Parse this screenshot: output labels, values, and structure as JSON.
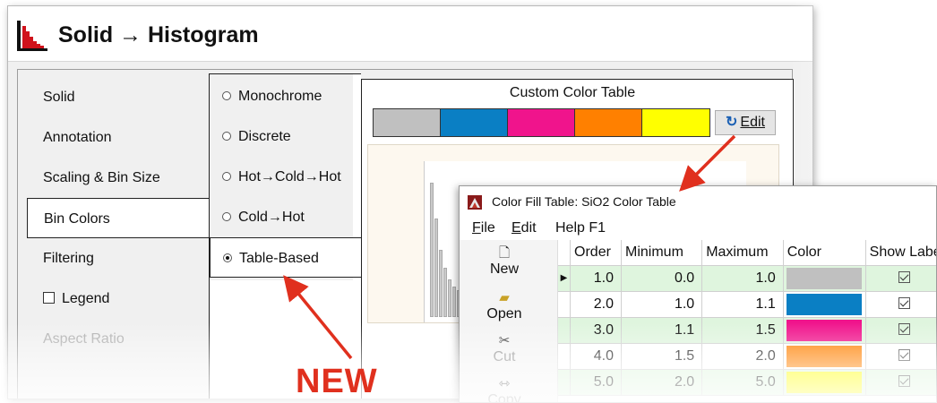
{
  "window": {
    "title": "Solid → Histogram"
  },
  "nav": {
    "items": [
      {
        "label": "Solid"
      },
      {
        "label": "Annotation"
      },
      {
        "label": "Scaling & Bin Size"
      },
      {
        "label": "Bin Colors"
      },
      {
        "label": "Filtering"
      },
      {
        "label": "Legend"
      },
      {
        "label": "Aspect Ratio"
      }
    ],
    "selected": "Bin Colors"
  },
  "color_mode": {
    "options": [
      {
        "label": "Monochrome"
      },
      {
        "label": "Discrete"
      },
      {
        "label": "Hot→Cold→Hot"
      },
      {
        "label": "Cold→Hot"
      },
      {
        "label": "Table-Based"
      }
    ],
    "selected": "Table-Based"
  },
  "custom_table": {
    "title": "Custom Color Table",
    "swatch_colors": [
      "#c0c0c0",
      "#0a7fc4",
      "#f0148c",
      "#ff8000",
      "#ffff00"
    ],
    "edit_label": "Edit"
  },
  "callout": {
    "new_label": "NEW",
    "arrow_color": "#e0301e"
  },
  "fill_table_window": {
    "title": "Color Fill Table: SiO2 Color Table",
    "menu": [
      {
        "label": "File",
        "mnemonic": "F"
      },
      {
        "label": "Edit",
        "mnemonic": "E"
      },
      {
        "label": "Help F1"
      }
    ],
    "toolbar": [
      {
        "label": "New",
        "icon": "new-file-icon"
      },
      {
        "label": "Open",
        "icon": "folder-open-icon"
      },
      {
        "label": "Cut",
        "icon": "scissors-icon"
      },
      {
        "label": "Copy",
        "icon": "copy-icon"
      }
    ],
    "columns": [
      "Order",
      "Minimum",
      "Maximum",
      "Color",
      "Show Labe"
    ],
    "rows": [
      {
        "order": "1.0",
        "minimum": "0.0",
        "maximum": "1.0",
        "color": "#c0c0c0"
      },
      {
        "order": "2.0",
        "minimum": "1.0",
        "maximum": "1.1",
        "color": "#0a7fc4"
      },
      {
        "order": "3.0",
        "minimum": "1.1",
        "maximum": "1.5",
        "color": "#f0148c"
      },
      {
        "order": "4.0",
        "minimum": "1.5",
        "maximum": "2.0",
        "color": "#ff8000"
      },
      {
        "order": "5.0",
        "minimum": "2.0",
        "maximum": "5.0",
        "color": "#ffff00"
      }
    ]
  }
}
